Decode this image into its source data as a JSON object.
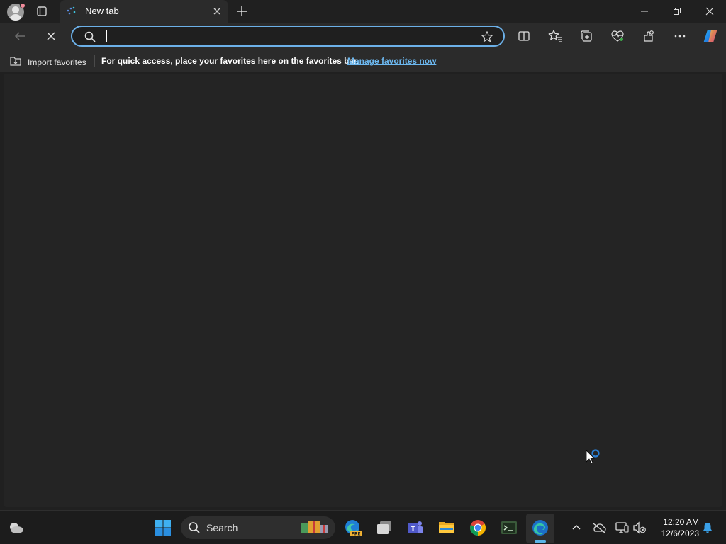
{
  "browser": {
    "tab": {
      "title": "New tab"
    },
    "address_bar": {
      "value": "",
      "placeholder": ""
    }
  },
  "favorites_bar": {
    "import_label": "Import favorites",
    "hint": "For quick access, place your favorites here on the favorites bar.",
    "manage_link": "Manage favorites now"
  },
  "taskbar": {
    "search_label": "Search",
    "time": "12:20 AM",
    "date": "12/6/2023"
  },
  "colors": {
    "accent": "#6cb0e8",
    "link": "#6cb8f0",
    "background": "#202020"
  },
  "icons": {
    "titlebar": [
      "profile-avatar",
      "tab-actions-icon",
      "new-tab-favicon",
      "close-tab-icon",
      "new-tab-plus-icon",
      "minimize-icon",
      "restore-icon",
      "close-window-icon"
    ],
    "toolbar": [
      "back-icon",
      "stop-loading-icon",
      "search-icon",
      "add-favorite-star-icon",
      "split-screen-icon",
      "favorites-icon",
      "collections-icon",
      "browser-essentials-icon",
      "extensions-icon",
      "more-icon",
      "copilot-icon"
    ],
    "taskbar": [
      "weather-icon",
      "windows-start-icon",
      "taskbar-search-icon",
      "edge-preview-icon",
      "task-view-icon",
      "teams-icon",
      "file-explorer-icon",
      "chrome-icon",
      "terminal-icon",
      "edge-icon",
      "show-hidden-icons-chevron",
      "onedrive-icon",
      "network-icon",
      "volume-muted-icon",
      "notification-bell-icon"
    ]
  }
}
